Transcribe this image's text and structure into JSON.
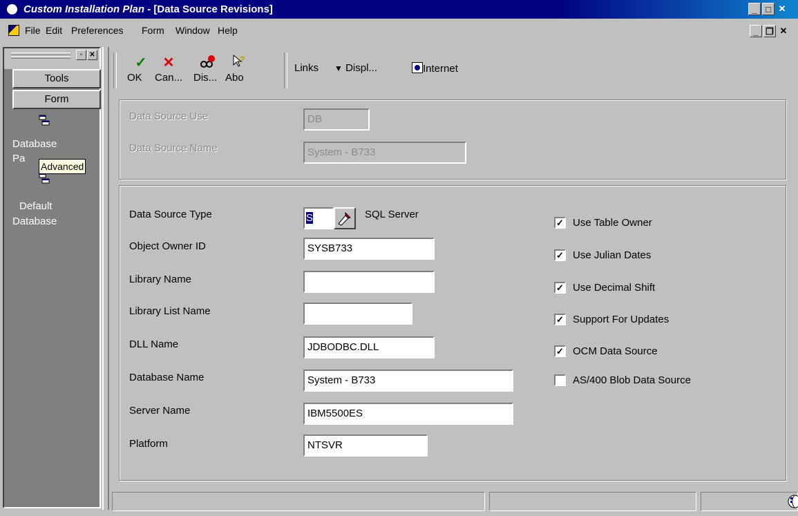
{
  "window": {
    "app_title": "Custom Installation Plan",
    "doc_title": " - [Data Source Revisions]"
  },
  "menu": {
    "file": "File",
    "edit": "Edit",
    "preferences": "Preferences",
    "form": "Form",
    "window": "Window",
    "help": "Help"
  },
  "left_panel": {
    "tools": "Tools",
    "form": "Form",
    "item1": "Database",
    "item1b": "Pa",
    "item2a": "Default",
    "item2b": "Database",
    "tooltip": "Advanced"
  },
  "toolbar": {
    "ok": "OK",
    "cancel": "Can...",
    "display": "Dis...",
    "about": "Abo",
    "links": "Links",
    "displ": "Displ...",
    "internet": "Internet"
  },
  "top_group": {
    "use_label": "Data Source Use",
    "use_value": "DB",
    "name_label": "Data Source Name",
    "name_value": "System - B733"
  },
  "form": {
    "type_label": "Data Source Type",
    "type_value": "S",
    "type_desc": "SQL Server",
    "owner_label": "Object Owner ID",
    "owner_value": "SYSB733",
    "library_label": "Library Name",
    "library_value": "",
    "liblist_label": "Library List Name",
    "liblist_value": "",
    "dll_label": "DLL Name",
    "dll_value": "JDBODBC.DLL",
    "dbname_label": "Database Name",
    "dbname_value": "System - B733",
    "server_label": "Server Name",
    "server_value": "IBM5500ES",
    "platform_label": "Platform",
    "platform_value": "NTSVR"
  },
  "checkboxes": [
    {
      "label": "Use Table Owner",
      "checked": true
    },
    {
      "label": "Use Julian Dates",
      "checked": true
    },
    {
      "label": "Use Decimal Shift",
      "checked": true
    },
    {
      "label": "Support For Updates",
      "checked": true
    },
    {
      "label": "OCM Data Source",
      "checked": true
    },
    {
      "label": "AS/400 Blob Data Source",
      "checked": false
    }
  ],
  "colors": {
    "titlebar": "#000080",
    "face": "#c0c0c0",
    "panel": "#808080",
    "tooltip": "#ffffe1"
  }
}
